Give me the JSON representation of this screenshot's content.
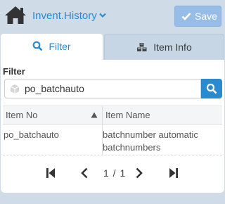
{
  "header": {
    "title": "Invent.History",
    "save_label": "Save"
  },
  "tabs": [
    {
      "label": "Filter",
      "icon": "search-icon",
      "active": true
    },
    {
      "label": "Item Info",
      "icon": "cubes-icon",
      "active": false
    }
  ],
  "filter": {
    "label": "Filter",
    "search_value": "po_batchauto"
  },
  "table": {
    "columns": [
      "Item No",
      "Item Name"
    ],
    "sort_column": "Item No",
    "rows": [
      {
        "item_no": "po_batchauto",
        "item_name": "batchnumber automatic batchnumbers"
      }
    ]
  },
  "pager": {
    "page_info": "1 / 1"
  },
  "colors": {
    "accent": "#2a8ad0",
    "save_disabled": "#97bde6",
    "background": "#cfdce8"
  }
}
